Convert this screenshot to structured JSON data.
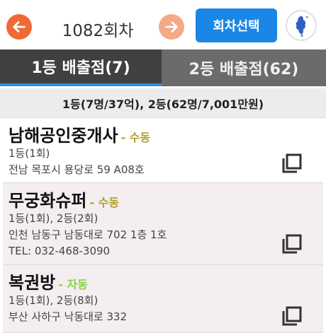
{
  "header": {
    "round_title": "1082회차",
    "select_label": "회차선택",
    "prev_icon": "arrow-left-icon",
    "next_icon": "arrow-right-icon",
    "flag_icon": "korea-unification-flag-icon",
    "colors": {
      "prev": "#f06a35",
      "next": "#f3aa85",
      "select": "#1a86e6"
    }
  },
  "tabs": [
    {
      "label": "1등 배출점(7)",
      "active": true
    },
    {
      "label": "2등 배출점(62)",
      "active": false
    }
  ],
  "summary": "1등(7명/37억), 2등(62명/7,001만원)",
  "stores": [
    {
      "name": "남해공인중개사",
      "type": "- 수동",
      "wins": "1등(1회)",
      "address": "전남 목포시 용당로 59 A08호",
      "tel": ""
    },
    {
      "name": "무궁화슈퍼",
      "type": "- 수동",
      "wins": "1등(1회), 2등(2회)",
      "address": "인천 남동구 남동대로 702 1층 1호",
      "tel": "TEL: 032-468-3090"
    },
    {
      "name": "복권방",
      "type": "- 자동",
      "wins": "1등(1회), 2등(8회)",
      "address": "부산 사하구 낙동대로 332",
      "tel": ""
    }
  ]
}
